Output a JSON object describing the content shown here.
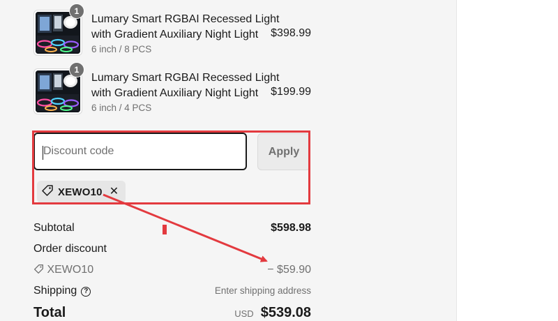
{
  "cart": {
    "items": [
      {
        "title": "Lumary Smart RGBAI Recessed Light with Gradient Auxiliary Night Light",
        "variant": "6 inch / 8 PCS",
        "price": "$398.99",
        "quantity": "1",
        "thumbnail_icon": "recessed-light-product-photo"
      },
      {
        "title": "Lumary Smart RGBAI Recessed Light with Gradient Auxiliary Night Light",
        "variant": "6 inch / 4 PCS",
        "price": "$199.99",
        "quantity": "1",
        "thumbnail_icon": "recessed-light-product-photo"
      }
    ]
  },
  "discount": {
    "placeholder": "Discount code",
    "apply_label": "Apply",
    "applied_code": "XEWO10",
    "tag_icon": "tag-icon",
    "remove_icon": "close-icon"
  },
  "totals": {
    "subtotal_label": "Subtotal",
    "subtotal_value": "$598.98",
    "order_discount_label": "Order discount",
    "discount_code": "XEWO10",
    "discount_value": "− $59.90",
    "shipping_label": "Shipping",
    "shipping_value": "Enter shipping address",
    "total_label": "Total",
    "currency": "USD",
    "total_value": "$539.08"
  },
  "colors": {
    "annotation_red": "#e33a3f",
    "panel_bg": "#f5f5f5",
    "muted_text": "#707070"
  }
}
